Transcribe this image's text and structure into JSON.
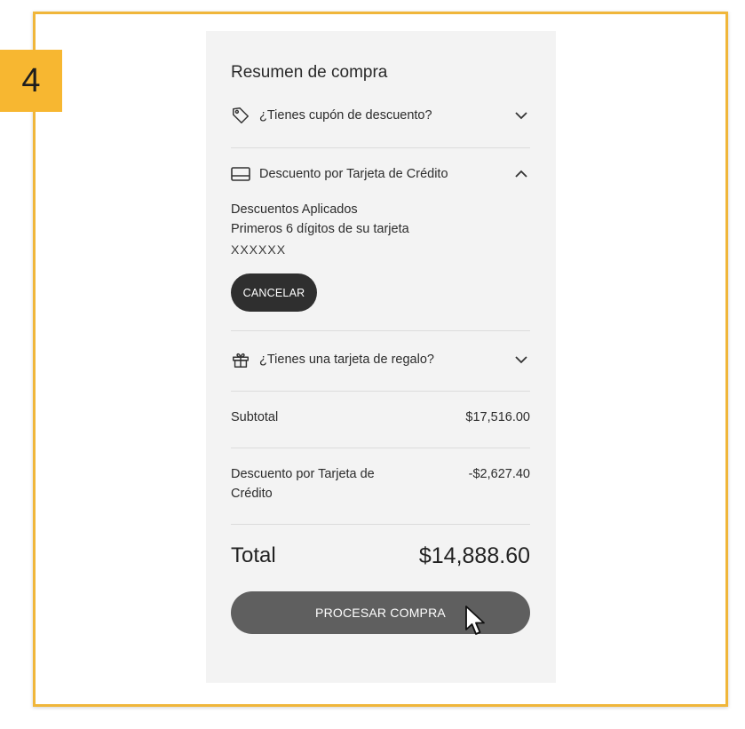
{
  "step_number": "4",
  "summary": {
    "title": "Resumen de compra",
    "coupon": {
      "label": "¿Tienes cupón de descuento?",
      "icon": "tag-icon",
      "expanded": false
    },
    "credit_card": {
      "label": "Descuento por Tarjeta de Crédito",
      "icon": "credit-card-icon",
      "expanded": true,
      "applied_label": "Descuentos Aplicados",
      "digits_label": "Primeros 6 dígitos de su tarjeta",
      "digits_value": "XXXXXX",
      "cancel_label": "CANCELAR"
    },
    "gift_card": {
      "label": "¿Tienes una tarjeta de regalo?",
      "icon": "gift-icon",
      "expanded": false
    },
    "subtotal": {
      "label": "Subtotal",
      "value": "$17,516.00"
    },
    "discount": {
      "label": "Descuento por Tarjeta de Crédito",
      "value": "-$2,627.40"
    },
    "total": {
      "label": "Total",
      "value": "$14,888.60"
    },
    "process_label": "PROCESAR COMPRA"
  },
  "colors": {
    "frame": "#f0b63a",
    "badge": "#f7b731",
    "panel": "#f3f3f3",
    "cancel_button": "#2f2f2f",
    "process_button": "#5f5f5f"
  }
}
